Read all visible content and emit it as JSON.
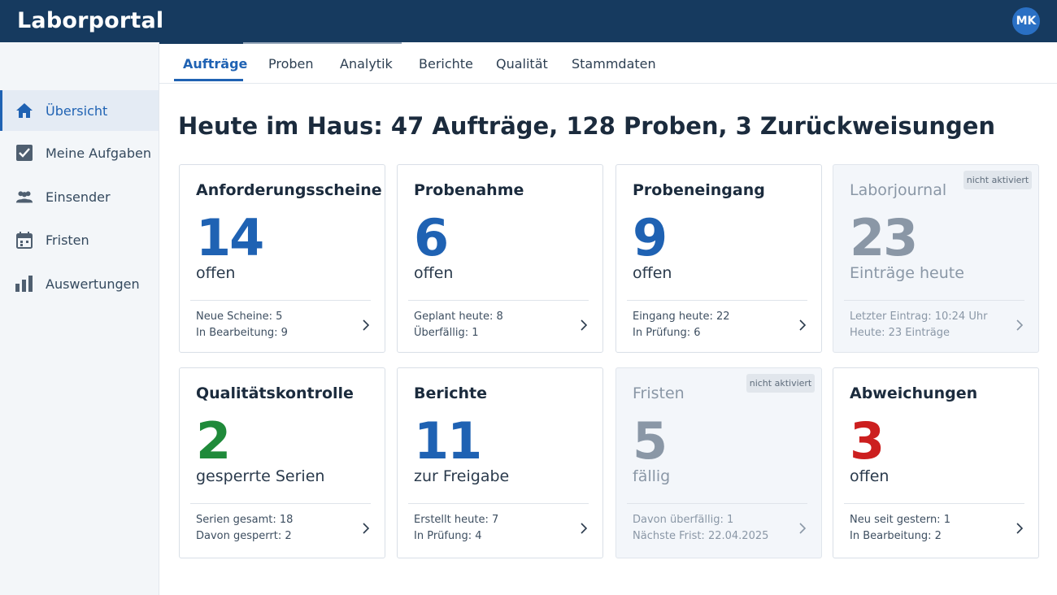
{
  "app": {
    "title": "Laborportal",
    "user_initials": "MK"
  },
  "sidebar": {
    "items": [
      {
        "label": "Übersicht",
        "icon": "home-icon",
        "active": true
      },
      {
        "label": "Meine Aufgaben",
        "icon": "checkbox-icon"
      },
      {
        "label": "Einsender",
        "icon": "people-icon"
      },
      {
        "label": "Fristen",
        "icon": "calendar-icon"
      },
      {
        "label": "Auswertungen",
        "icon": "bar-chart-icon"
      }
    ]
  },
  "tabs": [
    {
      "label": "Aufträge",
      "active": true
    },
    {
      "label": "Proben"
    },
    {
      "label": "Analytik"
    },
    {
      "label": "Berichte"
    },
    {
      "label": "Qualität"
    },
    {
      "label": "Stammdaten"
    }
  ],
  "headline": "Heute im Haus: 47 Aufträge, 128 Proben, 3 Zurückweisungen",
  "cards": [
    {
      "title": "Anforderungsscheine",
      "value": "14",
      "value_color": "#1f62b3",
      "subtitle": "offen",
      "line1": "Neue Scheine: 5",
      "line2": "In Bearbeitung: 9"
    },
    {
      "title": "Probenahme",
      "value": "6",
      "value_color": "#1f62b3",
      "subtitle": "offen",
      "line1": "Geplant heute: 8",
      "line2": "Überfällig: 1"
    },
    {
      "title": "Probeneingang",
      "value": "9",
      "value_color": "#1f62b3",
      "subtitle": "offen",
      "line1": "Eingang heute: 22",
      "line2": "In Prüfung: 6"
    },
    {
      "title": "Laborjournal",
      "value": "23",
      "value_color": "#8a97a6",
      "subtitle": "Einträge heute",
      "line1": "Letzter Eintrag: 10:24 Uhr",
      "line2": "Heute: 23 Einträge",
      "badge": "nicht aktiviert"
    },
    {
      "title": "Qualitätskontrolle",
      "value": "2",
      "value_color": "#1f8a3a",
      "subtitle": "gesperrte Serien",
      "line1": "Serien gesamt: 18",
      "line2": "Davon gesperrt: 2"
    },
    {
      "title": "Berichte",
      "value": "11",
      "value_color": "#1f62b3",
      "subtitle": "zur Freigabe",
      "line1": "Erstellt heute: 7",
      "line2": "In Prüfung: 4"
    },
    {
      "title": "Fristen",
      "value": "5",
      "value_color": "#8a97a6",
      "subtitle": "fällig",
      "line1": "Davon überfällig: 1",
      "line2": "Nächste Frist: 22.04.2025",
      "badge": "nicht aktiviert"
    },
    {
      "title": "Abweichungen",
      "value": "3",
      "value_color": "#cc1f1f",
      "subtitle": "offen",
      "line1": "Neu seit gestern: 1",
      "line2": "In Bearbeitung: 2"
    }
  ],
  "colors": {
    "header_bg": "#163a5f",
    "accent": "#1f62b3",
    "ok": "#1f8a3a",
    "alert": "#cc1f1f",
    "muted": "#8a97a6"
  }
}
